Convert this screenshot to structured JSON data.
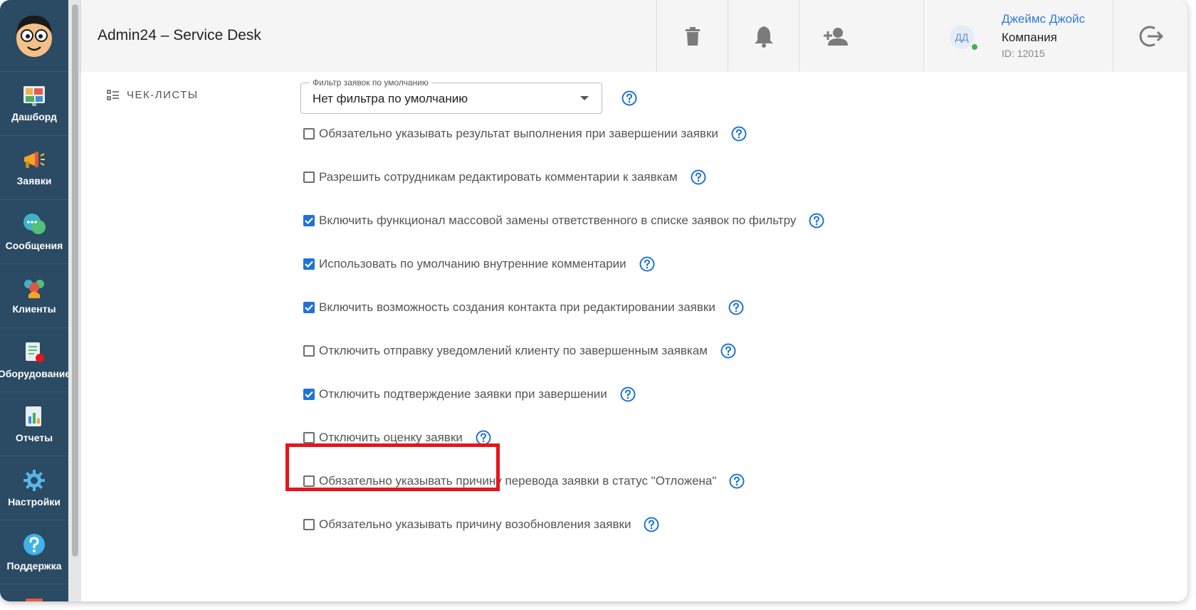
{
  "app": {
    "title": "Admin24 – Service Desk"
  },
  "sidebar": {
    "items": [
      {
        "label": "Дашборд",
        "icon": "dashboard-icon"
      },
      {
        "label": "Заявки",
        "icon": "megaphone-icon"
      },
      {
        "label": "Сообщения",
        "icon": "chat-icon"
      },
      {
        "label": "Клиенты",
        "icon": "clients-icon"
      },
      {
        "label": "Оборудование",
        "icon": "equipment-icon"
      },
      {
        "label": "Отчеты",
        "icon": "report-icon"
      },
      {
        "label": "Настройки",
        "icon": "gear-icon"
      },
      {
        "label": "Поддержка",
        "icon": "question-icon"
      }
    ]
  },
  "header": {
    "user": {
      "initials": "ДД",
      "name": "Джеймс Джойс",
      "company": "Компания",
      "id": "ID: 12015"
    }
  },
  "main": {
    "section_label": "ЧЕК-ЛИСТЫ",
    "filter": {
      "legend": "Фильтр заявок по умолчанию",
      "value": "Нет фильтра по умолчанию"
    },
    "options": [
      {
        "label": "Обязательно указывать результат выполнения при завершении заявки",
        "checked": false
      },
      {
        "label": "Разрешить сотрудникам редактировать комментарии к заявкам",
        "checked": false
      },
      {
        "label": "Включить функционал массовой замены ответственного в списке заявок по фильтру",
        "checked": true
      },
      {
        "label": "Использовать по умолчанию внутренние комментарии",
        "checked": true
      },
      {
        "label": "Включить возможность создания контакта при редактировании заявки",
        "checked": true
      },
      {
        "label": "Отключить отправку уведомлений клиенту по завершенным заявкам",
        "checked": false
      },
      {
        "label": "Отключить подтверждение заявки при завершении",
        "checked": true
      },
      {
        "label": "Отключить оценку заявки",
        "checked": false
      },
      {
        "label": "Обязательно указывать причину перевода заявки в статус \"Отложена\"",
        "checked": false
      },
      {
        "label": "Обязательно указывать причину возобновления заявки",
        "checked": false
      }
    ]
  },
  "colors": {
    "accent": "#1f73d6",
    "sidebar": "#2b4a63",
    "highlight": "#e8141b",
    "online": "#3bb54a"
  }
}
